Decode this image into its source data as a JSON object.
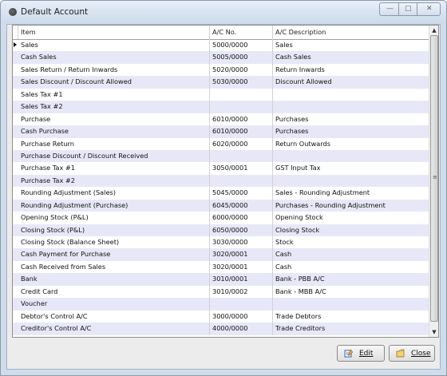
{
  "window": {
    "title": "Default Account"
  },
  "grid": {
    "columns": [
      "Item",
      "A/C No.",
      "A/C Description"
    ],
    "rows": [
      [
        "Sales",
        "5000/0000",
        "Sales"
      ],
      [
        "Cash Sales",
        "5005/0000",
        "Cash Sales"
      ],
      [
        "Sales Return / Return Inwards",
        "5020/0000",
        "Return Inwards"
      ],
      [
        "Sales Discount / Discount Allowed",
        "5030/0000",
        "Discount Allowed"
      ],
      [
        "Sales Tax #1",
        "",
        ""
      ],
      [
        "Sales Tax #2",
        "",
        ""
      ],
      [
        "Purchase",
        "6010/0000",
        "Purchases"
      ],
      [
        "Cash Purchase",
        "6010/0000",
        "Purchases"
      ],
      [
        "Purchase Return",
        "6020/0000",
        "Return Outwards"
      ],
      [
        "Purchase Discount / Discount Received",
        "",
        ""
      ],
      [
        "Purchase Tax #1",
        "3050/0001",
        "GST Input Tax"
      ],
      [
        "Purchase Tax #2",
        "",
        ""
      ],
      [
        "Rounding Adjustment (Sales)",
        "5045/0000",
        "Sales - Rounding Adjustment"
      ],
      [
        "Rounding Adjustment (Purchase)",
        "6045/0000",
        "Purchases - Rounding Adjustment"
      ],
      [
        "Opening Stock (P&L)",
        "6000/0000",
        "Opening Stock"
      ],
      [
        "Closing Stock (P&L)",
        "6050/0000",
        "Closing Stock"
      ],
      [
        "Closing Stock (Balance Sheet)",
        "3030/0000",
        "Stock"
      ],
      [
        "Cash Payment for Purchase",
        "3020/0001",
        "Cash"
      ],
      [
        "Cash Received from Sales",
        "3020/0001",
        "Cash"
      ],
      [
        "Bank",
        "3010/0001",
        "Bank - PBB A/C"
      ],
      [
        "Credit Card",
        "3010/0002",
        "Bank - MBB A/C"
      ],
      [
        "Voucher",
        "",
        ""
      ],
      [
        "Debtor's Control A/C",
        "3000/0000",
        "Trade Debtors"
      ],
      [
        "Creditor's Control A/C",
        "4000/0000",
        "Trade Creditors"
      ]
    ],
    "selected_row": 0,
    "alt_row_color": "#e7e8f7"
  },
  "buttons": {
    "edit": "Edit",
    "close": "Close"
  },
  "icons": {
    "edit": "edit-pencil-icon",
    "close": "close-folder-icon"
  }
}
